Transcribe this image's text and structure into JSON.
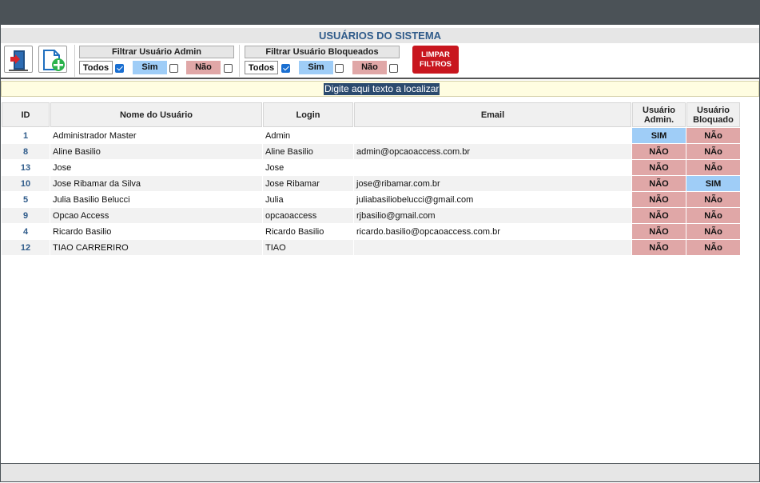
{
  "header": {
    "title": "USUÁRIOS DO SISTEMA"
  },
  "toolbar": {
    "exit_icon": "exit-door-icon",
    "new_icon": "new-document-plus-icon",
    "filter_admin": {
      "label": "Filtrar Usuário Admin",
      "todos": "Todos",
      "sim": "Sim",
      "nao": "Não",
      "todos_checked": true,
      "sim_checked": false,
      "nao_checked": false
    },
    "filter_blocked": {
      "label": "Filtrar Usuário Bloqueados",
      "todos": "Todos",
      "sim": "Sim",
      "nao": "Não",
      "todos_checked": true,
      "sim_checked": false,
      "nao_checked": false
    },
    "clear_filters_line1": "LIMPAR",
    "clear_filters_line2": "FILTROS"
  },
  "search": {
    "value": "Digite aqui texto a localizar"
  },
  "table": {
    "columns": {
      "id": "ID",
      "name": "Nome do Usuário",
      "login": "Login",
      "email": "Email",
      "admin_line1": "Usuário",
      "admin_line2": "Admin.",
      "blocked_line1": "Usuário",
      "blocked_line2": "Bloquado"
    },
    "rows": [
      {
        "id": "1",
        "name": "Administrador Master",
        "login": "Admin",
        "email": "",
        "admin": "SIM",
        "blocked": "NÃo"
      },
      {
        "id": "8",
        "name": "Aline Basilio",
        "login": "Aline Basilio",
        "email": "admin@opcaoaccess.com.br",
        "admin": "NÃO",
        "blocked": "NÃo"
      },
      {
        "id": "13",
        "name": "Jose",
        "login": "Jose",
        "email": "",
        "admin": "NÃO",
        "blocked": "NÃo"
      },
      {
        "id": "10",
        "name": "Jose Ribamar da Silva",
        "login": "Jose Ribamar",
        "email": "jose@ribamar.com.br",
        "admin": "NÃO",
        "blocked": "SIM"
      },
      {
        "id": "5",
        "name": "Julia Basilio Belucci",
        "login": "Julia",
        "email": "juliabasiliobelucci@gmail.com",
        "admin": "NÃO",
        "blocked": "NÃo"
      },
      {
        "id": "9",
        "name": "Opcao Access",
        "login": "opcaoaccess",
        "email": "rjbasilio@gmail.com",
        "admin": "NÃO",
        "blocked": "NÃo"
      },
      {
        "id": "4",
        "name": "Ricardo Basilio",
        "login": "Ricardo Basilio",
        "email": "ricardo.basilio@opcaoaccess.com.br",
        "admin": "NÃO",
        "blocked": "NÃo"
      },
      {
        "id": "12",
        "name": "TIAO CARRERIRO",
        "login": "TIAO",
        "email": "",
        "admin": "NÃO",
        "blocked": "NÃo"
      }
    ]
  },
  "colors": {
    "titlebar": "#4b5257",
    "sim": "#9fcdf7",
    "nao": "#e0a7a7",
    "clear_button": "#c8161e",
    "header_text": "#2f5b8a"
  }
}
